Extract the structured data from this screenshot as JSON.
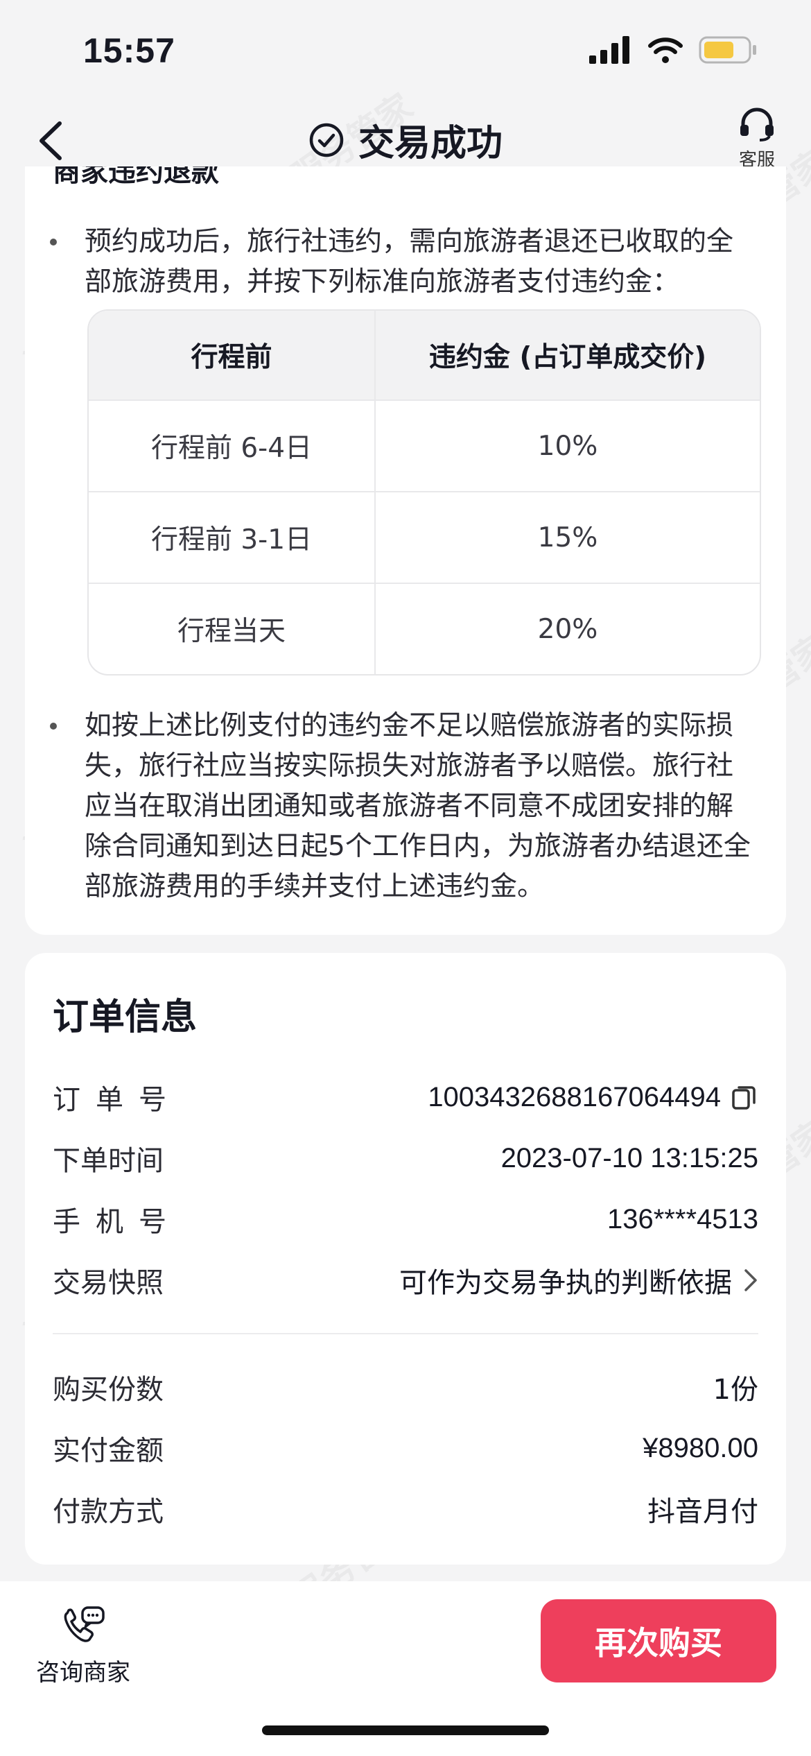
{
  "status_bar": {
    "time": "15:57"
  },
  "nav": {
    "title": "交易成功",
    "service_label": "客服"
  },
  "policy": {
    "section_title": "商家违约退款",
    "bullet1": "预约成功后，旅行社违约，需向旅游者退还已收取的全部旅游费用，并按下列标准向旅游者支付违约金：",
    "table": {
      "headers": [
        "行程前",
        "违约金 (占订单成交价)"
      ],
      "rows": [
        [
          "行程前 6-4日",
          "10%"
        ],
        [
          "行程前 3-1日",
          "15%"
        ],
        [
          "行程当天",
          "20%"
        ]
      ]
    },
    "bullet2": "如按上述比例支付的违约金不足以赔偿旅游者的实际损失，旅行社应当按实际损失对旅游者予以赔偿。旅行社应当在取消出团通知或者旅游者不同意不成团安排的解除合同通知到达日起5个工作日内，为旅游者办结退还全部旅游费用的手续并支付上述违约金。"
  },
  "order": {
    "title": "订单信息",
    "order_no_label": "订单号",
    "order_no": "1003432688167064494",
    "time_label": "下单时间",
    "time": "2023-07-10 13:15:25",
    "phone_label": "手机号",
    "phone": "136****4513",
    "snapshot_label": "交易快照",
    "snapshot_value": "可作为交易争执的判断依据",
    "qty_label": "购买份数",
    "qty": "1份",
    "paid_label": "实付金额",
    "paid": "¥8980.00",
    "method_label": "付款方式",
    "method": "抖音月付"
  },
  "bottom": {
    "consult_label": "咨询商家",
    "rebuy_label": "再次购买"
  },
  "watermark": "消费保 您身边的消费服务管家",
  "icons": {
    "back": "chevron-left-icon",
    "success": "check-circle-icon",
    "service": "headset-icon",
    "copy": "copy-icon",
    "chevron": "chevron-right-icon",
    "consult": "phone-chat-icon"
  },
  "colors": {
    "accent": "#ee3f5c",
    "battery": "#f5c842"
  }
}
